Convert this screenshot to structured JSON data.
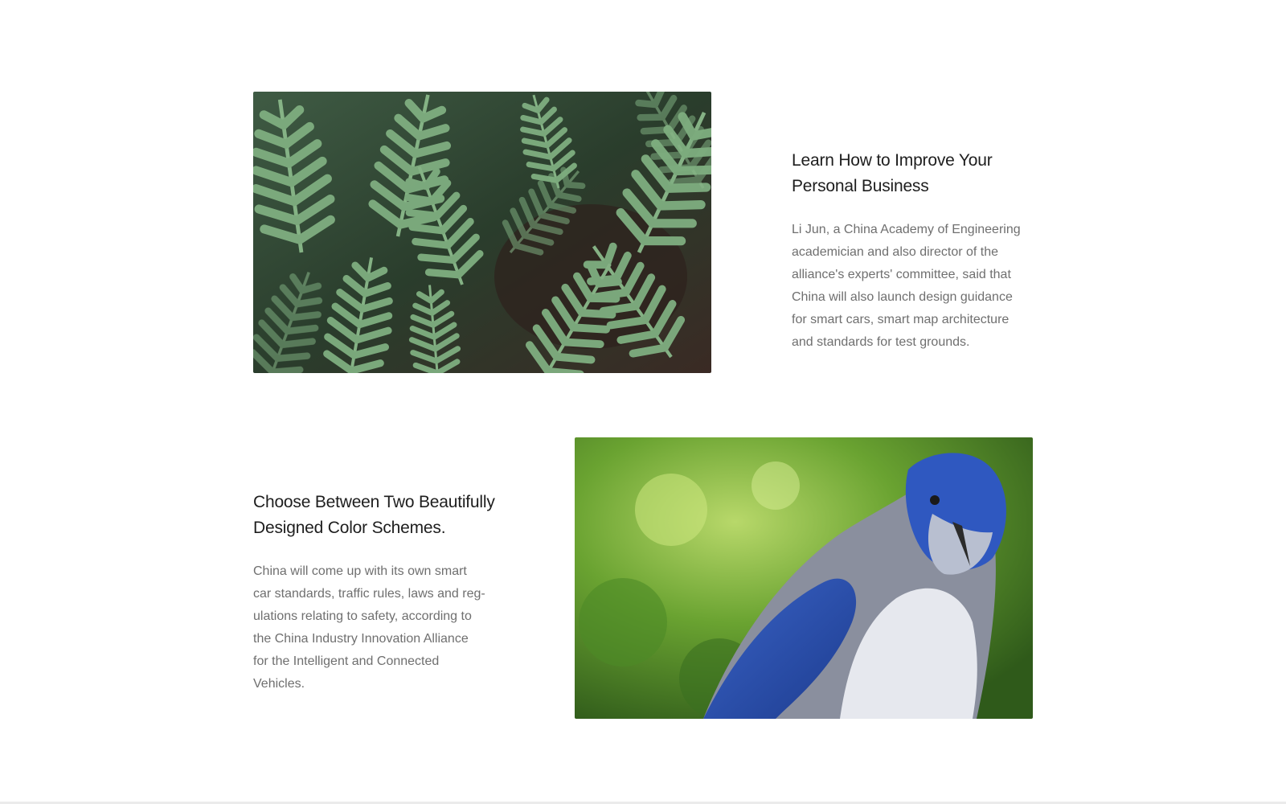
{
  "features": [
    {
      "image_alt": "fern-leaves-photo",
      "title": "Learn How to Improve Your\nPersonal Business",
      "body": "Li Jun, a China Academy of Engineering\nacademician and also director of the\nalliance's experts' committee, said that\nChina will also launch design guidance\nfor smart cars, smart map architecture\nand standards for test grounds."
    },
    {
      "image_alt": "blue-jay-bird-photo",
      "title": "Choose Between Two Beautifully\nDesigned Color Schemes.",
      "body": "China will come up with its own smart\ncar standards, traffic rules, laws and reg-\nulations relating to safety, according to\nthe China Industry Innovation Alliance\nfor the Intelligent and Connected\nVehicles."
    }
  ],
  "colors": {
    "title": "#1e1e1e",
    "body": "#6f6f6f",
    "background": "#ffffff",
    "fern_dark": "#2a3d2c",
    "fern_light": "#7fae80",
    "bird_blue": "#2a4fb0",
    "bokeh_green": "#6aa331"
  }
}
